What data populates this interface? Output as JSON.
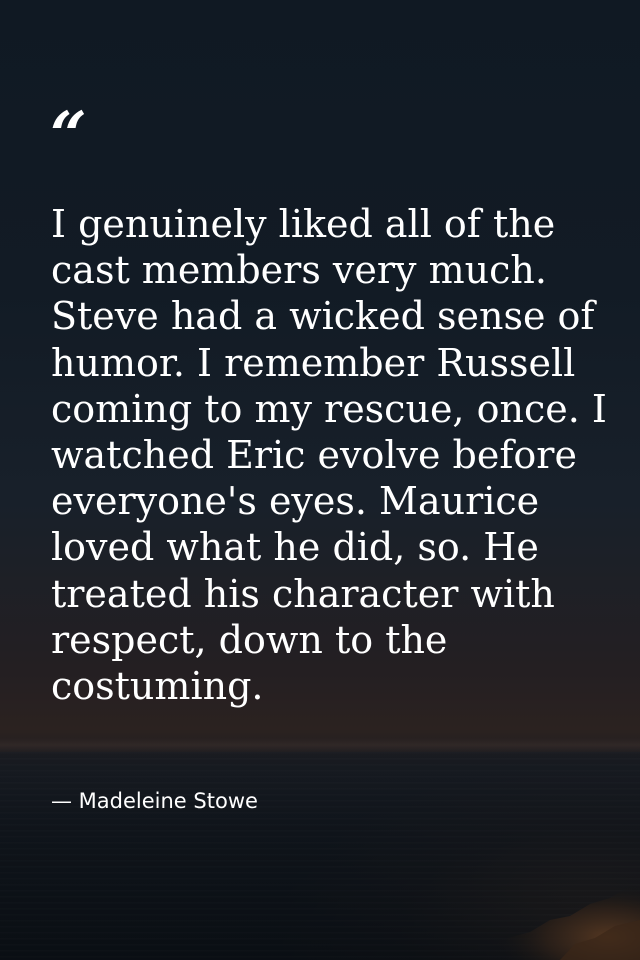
{
  "quote": {
    "mark": "“",
    "text": "I genuinely liked all of the cast members very much. Steve had a wicked sense of humor. I remember Russell coming to my rescue, once. I watched Eric evolve before everyone's eyes. Maurice loved what he did, so. He treated his character with respect, down to the costuming.",
    "author": "— Madeleine Stowe"
  },
  "colors": {
    "text": "#ffffff",
    "sky_top": "#101923",
    "sunset_glow": "#2b2220",
    "sea": "#0b1117"
  }
}
